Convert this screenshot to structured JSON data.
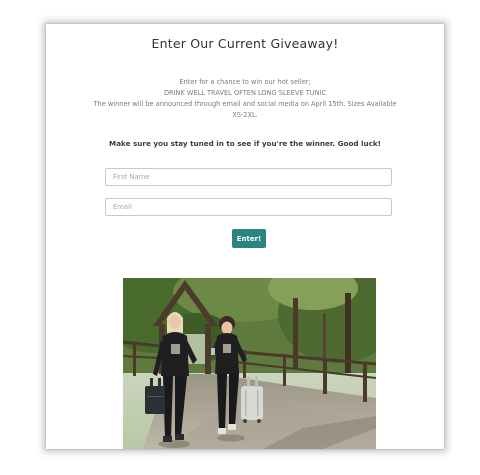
{
  "giveaway": {
    "title": "Enter Our Current Giveaway!",
    "description_lines": [
      "Enter for a chance to win our hot seller;",
      "DRINK WELL TRAVEL OFTEN LONG SLEEVE TUNIC",
      "The winner will be announced through email and social media on April 15th. Sizes Available",
      "XS-2XL."
    ],
    "good_luck": "Make sure you stay tuned in to see if you're the winner. Good luck!",
    "form": {
      "first_name_placeholder": "First Name",
      "email_placeholder": "Email",
      "submit_label": "Enter!"
    }
  },
  "colors": {
    "button": "#2a8480",
    "title_text": "#333333",
    "body_text": "#7a7a7a"
  },
  "photo": {
    "subject": "two women in black tunics walking with luggage across a wooden covered bridge"
  }
}
